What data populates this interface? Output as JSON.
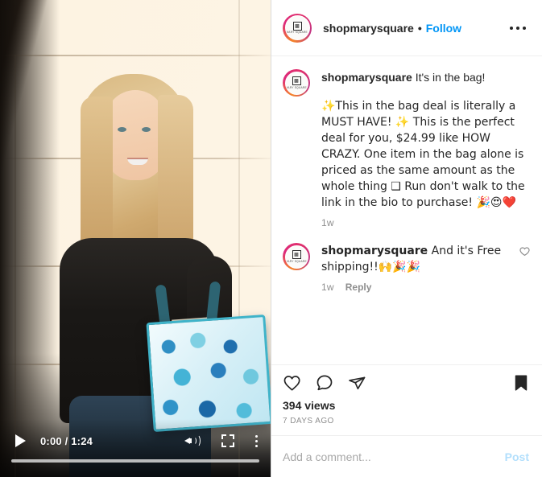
{
  "video": {
    "play_label": "play-button",
    "time_display": "0:00 / 1:24",
    "current_time": "0:00",
    "duration": "1:24",
    "progress_percent": 0,
    "volume_icon": "volume-on-icon",
    "fullscreen_icon": "fullscreen-icon",
    "settings_icon": "more-options-icon"
  },
  "header": {
    "username": "shopmarysquare",
    "separator": "•",
    "follow_label": "Follow",
    "more_icon": "more-options-icon",
    "avatar_logo_glyph": "▩",
    "avatar_logo_text": "MARY SQUARE"
  },
  "caption": {
    "username": "shopmarysquare",
    "title": "It's in the bag!",
    "body": "✨This in the bag deal is literally a MUST HAVE! ✨ This is the perfect deal for you, $24.99 like HOW CRAZY. One item in the bag alone is priced as the same amount as the whole thing ❑ Run don't walk to the link in the bio to purchase! 🎉😍❤️",
    "time_ago": "1w"
  },
  "comments": [
    {
      "username": "shopmarysquare",
      "text": "And it's Free shipping!!🙌🎉🎉",
      "time_ago": "1w",
      "reply_label": "Reply",
      "like_icon": "heart-outline-icon"
    }
  ],
  "actions": {
    "like_icon": "heart-outline-icon",
    "comment_icon": "comment-bubble-icon",
    "share_icon": "share-paper-plane-icon",
    "save_icon": "bookmark-filled-icon",
    "saved": true
  },
  "stats": {
    "views": "394 views",
    "date": "7 DAYS AGO"
  },
  "comment_form": {
    "placeholder": "Add a comment...",
    "value": "",
    "post_label": "Post"
  },
  "colors": {
    "link_blue": "#0095f6",
    "post_disabled_blue": "#b2dffc",
    "text_primary": "#262626",
    "text_secondary": "#8e8e8e",
    "divider": "#efefef"
  }
}
